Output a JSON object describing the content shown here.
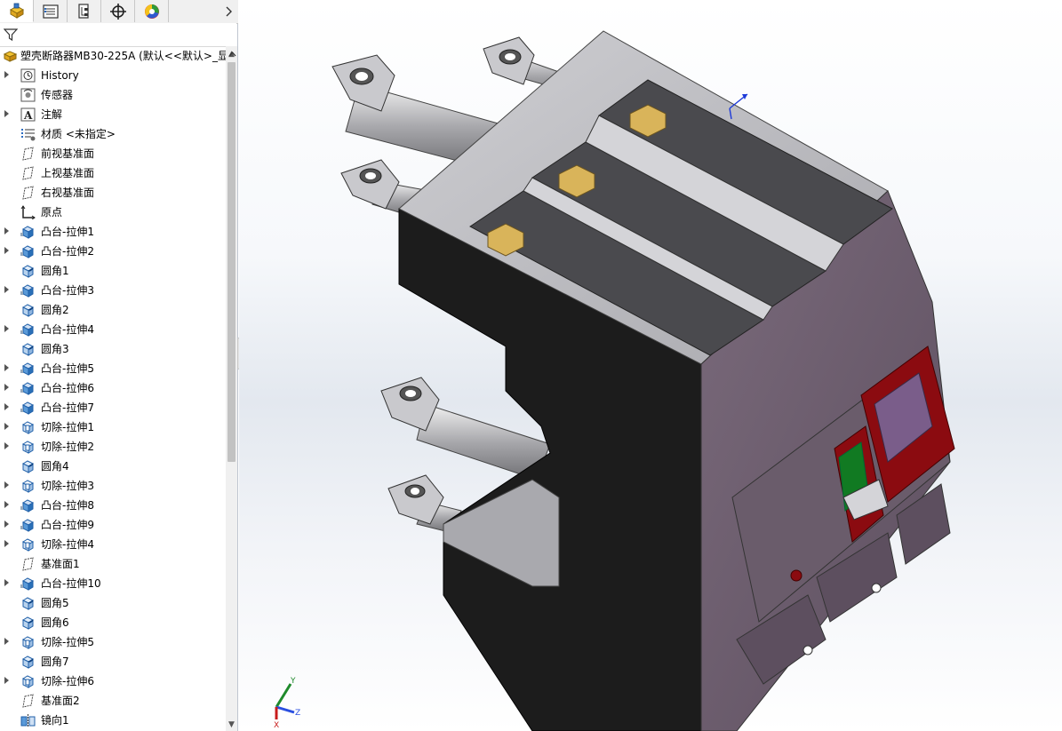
{
  "tabs": [
    {
      "icon": "feature-manager-icon",
      "active": true
    },
    {
      "icon": "property-manager-icon",
      "active": false
    },
    {
      "icon": "configuration-manager-icon",
      "active": false
    },
    {
      "icon": "dimxpert-manager-icon",
      "active": false
    },
    {
      "icon": "display-manager-icon",
      "active": false
    }
  ],
  "tree": {
    "root_label": "塑壳断路器MB30-225A  (默认<<默认>_显",
    "items": [
      {
        "label": "History",
        "icon": "history-icon",
        "expandable": true
      },
      {
        "label": "传感器",
        "icon": "sensor-icon",
        "expandable": false
      },
      {
        "label": "注解",
        "icon": "annotation-icon",
        "expandable": true
      },
      {
        "label": "材质 <未指定>",
        "icon": "material-icon",
        "expandable": false
      },
      {
        "label": "前视基准面",
        "icon": "plane-icon",
        "expandable": false
      },
      {
        "label": "上视基准面",
        "icon": "plane-icon",
        "expandable": false
      },
      {
        "label": "右视基准面",
        "icon": "plane-icon",
        "expandable": false
      },
      {
        "label": "原点",
        "icon": "origin-icon",
        "expandable": false
      },
      {
        "label": "凸台-拉伸1",
        "icon": "boss-extrude-icon",
        "expandable": true
      },
      {
        "label": "凸台-拉伸2",
        "icon": "boss-extrude-icon",
        "expandable": true
      },
      {
        "label": "圆角1",
        "icon": "fillet-icon",
        "expandable": false
      },
      {
        "label": "凸台-拉伸3",
        "icon": "boss-extrude-icon",
        "expandable": true
      },
      {
        "label": "圆角2",
        "icon": "fillet-icon",
        "expandable": false
      },
      {
        "label": "凸台-拉伸4",
        "icon": "boss-extrude-icon",
        "expandable": true
      },
      {
        "label": "圆角3",
        "icon": "fillet-icon",
        "expandable": false
      },
      {
        "label": "凸台-拉伸5",
        "icon": "boss-extrude-icon",
        "expandable": true
      },
      {
        "label": "凸台-拉伸6",
        "icon": "boss-extrude-icon",
        "expandable": true
      },
      {
        "label": "凸台-拉伸7",
        "icon": "boss-extrude-icon",
        "expandable": true
      },
      {
        "label": "切除-拉伸1",
        "icon": "cut-extrude-icon",
        "expandable": true
      },
      {
        "label": "切除-拉伸2",
        "icon": "cut-extrude-icon",
        "expandable": true
      },
      {
        "label": "圆角4",
        "icon": "fillet-icon",
        "expandable": false
      },
      {
        "label": "切除-拉伸3",
        "icon": "cut-extrude-icon",
        "expandable": true
      },
      {
        "label": "凸台-拉伸8",
        "icon": "boss-extrude-icon",
        "expandable": true
      },
      {
        "label": "凸台-拉伸9",
        "icon": "boss-extrude-icon",
        "expandable": true
      },
      {
        "label": "切除-拉伸4",
        "icon": "cut-extrude-icon",
        "expandable": true
      },
      {
        "label": "基准面1",
        "icon": "plane-icon",
        "expandable": false
      },
      {
        "label": "凸台-拉伸10",
        "icon": "boss-extrude-icon",
        "expandable": true
      },
      {
        "label": "圆角5",
        "icon": "fillet-icon",
        "expandable": false
      },
      {
        "label": "圆角6",
        "icon": "fillet-icon",
        "expandable": false
      },
      {
        "label": "切除-拉伸5",
        "icon": "cut-extrude-icon",
        "expandable": true
      },
      {
        "label": "圆角7",
        "icon": "fillet-icon",
        "expandable": false
      },
      {
        "label": "切除-拉伸6",
        "icon": "cut-extrude-icon",
        "expandable": true
      },
      {
        "label": "基准面2",
        "icon": "plane-icon",
        "expandable": false
      },
      {
        "label": "镜向1",
        "icon": "mirror-icon",
        "expandable": false
      }
    ]
  },
  "triad": {
    "x": "X",
    "y": "Y",
    "z": "Z"
  },
  "colors": {
    "body_dark": "#1c1c1c",
    "body_grey": "#b9b9bd",
    "purple_side": "#6e5f6e",
    "window_red": "#8b0b10",
    "window_purple": "#7a5d8a",
    "indicator_green": "#117a22",
    "nut_gold": "#d9b45a"
  }
}
